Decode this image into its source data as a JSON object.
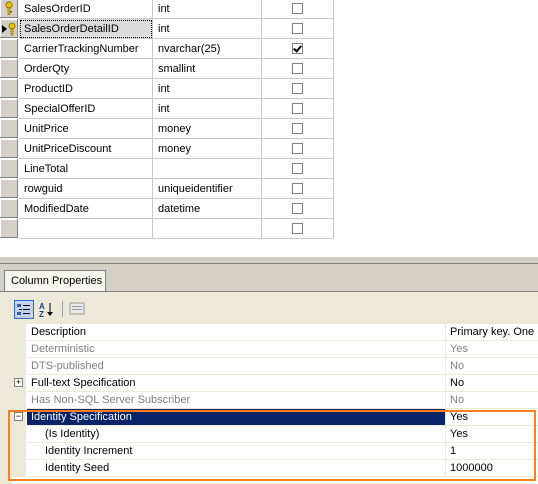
{
  "columns_grid": {
    "rows": [
      {
        "name": "SalesOrderID",
        "type": "int",
        "allow_nulls": false,
        "marker": "key"
      },
      {
        "name": "SalesOrderDetailID",
        "type": "int",
        "allow_nulls": false,
        "marker": "current-key"
      },
      {
        "name": "CarrierTrackingNumber",
        "type": "nvarchar(25)",
        "allow_nulls": true,
        "marker": ""
      },
      {
        "name": "OrderQty",
        "type": "smallint",
        "allow_nulls": false,
        "marker": ""
      },
      {
        "name": "ProductID",
        "type": "int",
        "allow_nulls": false,
        "marker": ""
      },
      {
        "name": "SpecialOfferID",
        "type": "int",
        "allow_nulls": false,
        "marker": ""
      },
      {
        "name": "UnitPrice",
        "type": "money",
        "allow_nulls": false,
        "marker": ""
      },
      {
        "name": "UnitPriceDiscount",
        "type": "money",
        "allow_nulls": false,
        "marker": ""
      },
      {
        "name": "LineTotal",
        "type": "",
        "allow_nulls": false,
        "marker": ""
      },
      {
        "name": "rowguid",
        "type": "uniqueidentifier",
        "allow_nulls": false,
        "marker": ""
      },
      {
        "name": "ModifiedDate",
        "type": "datetime",
        "allow_nulls": false,
        "marker": ""
      },
      {
        "name": "",
        "type": "",
        "allow_nulls": false,
        "marker": ""
      }
    ]
  },
  "panel": {
    "tab_label": "Column Properties"
  },
  "toolbar": {
    "categorized_icon": "categorized-icon",
    "alphabetical_icon": "alphabetical-icon",
    "property-pages-icon": "property-pages-icon"
  },
  "properties": [
    {
      "name": "Description",
      "value": "Primary key. One i",
      "gray": false,
      "expander": "",
      "indent": false
    },
    {
      "name": "Deterministic",
      "value": "Yes",
      "gray": true,
      "expander": "",
      "indent": false
    },
    {
      "name": "DTS-published",
      "value": "No",
      "gray": true,
      "expander": "",
      "indent": false
    },
    {
      "name": "Full-text Specification",
      "value": "No",
      "gray": false,
      "expander": "+",
      "indent": false
    },
    {
      "name": "Has Non-SQL Server Subscriber",
      "value": "No",
      "gray": true,
      "expander": "",
      "indent": false
    },
    {
      "name": "Identity Specification",
      "value": "Yes",
      "gray": false,
      "expander": "−",
      "indent": false,
      "selected": true
    },
    {
      "name": "(Is Identity)",
      "value": "Yes",
      "gray": false,
      "expander": "",
      "indent": true
    },
    {
      "name": "Identity Increment",
      "value": "1",
      "gray": false,
      "expander": "",
      "indent": true
    },
    {
      "name": "Identity Seed",
      "value": "1000000",
      "gray": false,
      "expander": "",
      "indent": true
    }
  ],
  "colors": {
    "selection": "#0a246a",
    "highlight_box": "#ff7f1a",
    "chrome": "#d4d0c8"
  }
}
